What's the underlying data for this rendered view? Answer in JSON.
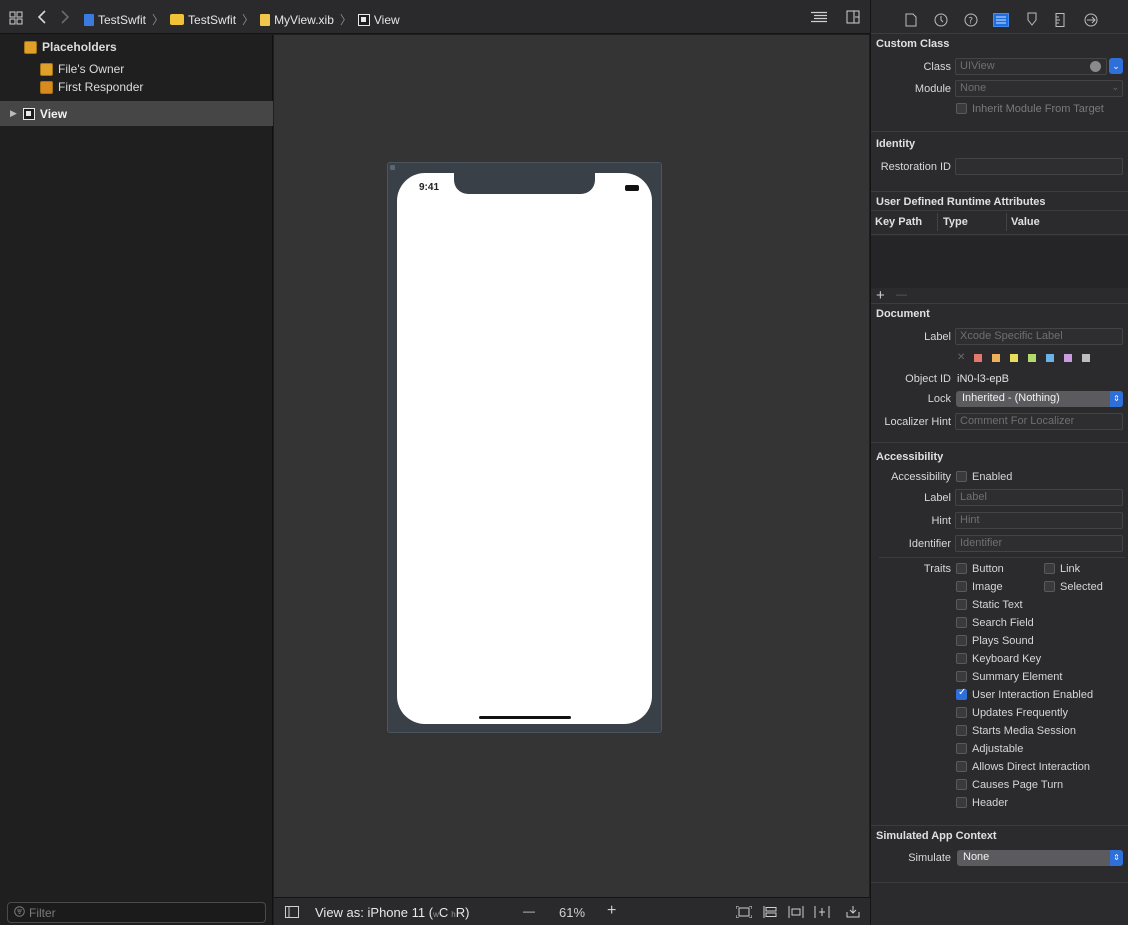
{
  "breadcrumb": {
    "items": [
      {
        "label": "TestSwfit"
      },
      {
        "label": "TestSwfit"
      },
      {
        "label": "MyView.xib"
      },
      {
        "label": "View"
      }
    ]
  },
  "outline": {
    "placeholders_label": "Placeholders",
    "files_owner_label": "File's Owner",
    "first_responder_label": "First Responder",
    "view_label": "View"
  },
  "filter": {
    "placeholder": "Filter"
  },
  "canvas": {
    "status_time": "9:41"
  },
  "bottombar": {
    "view_as_prefix": "View as: ",
    "device": "iPhone 11",
    "size_class_open": " (",
    "w_letter": "w",
    "compact_1": "C",
    "h_letter": "h",
    "regular": "R",
    "size_class_close": ")",
    "zoom": "61%",
    "zoom_out": "—",
    "zoom_in": "+"
  },
  "inspector": {
    "custom_class": {
      "title": "Custom Class",
      "class_label": "Class",
      "class_placeholder": "UIView",
      "module_label": "Module",
      "module_placeholder": "None",
      "inherit_label": "Inherit Module From Target"
    },
    "identity": {
      "title": "Identity",
      "restoration_label": "Restoration ID"
    },
    "runtime_attrs": {
      "title": "User Defined Runtime Attributes",
      "col_key": "Key Path",
      "col_type": "Type",
      "col_value": "Value",
      "add": "+",
      "remove": "—"
    },
    "document": {
      "title": "Document",
      "label_label": "Label",
      "label_placeholder": "Xcode Specific Label",
      "clear_mark": "✕",
      "object_id_label": "Object ID",
      "object_id": "iN0-l3-epB",
      "lock_label": "Lock",
      "lock_value": "Inherited - (Nothing)",
      "localizer_label": "Localizer Hint",
      "localizer_placeholder": "Comment For Localizer",
      "swatch_colors": [
        "#e5786d",
        "#eeb05c",
        "#e9de5c",
        "#b4d96b",
        "#6bb2e8",
        "#c99be0",
        "#bdbdbd"
      ]
    },
    "accessibility": {
      "title": "Accessibility",
      "accessibility_label": "Accessibility",
      "enabled_label": "Enabled",
      "label_label": "Label",
      "label_placeholder": "Label",
      "hint_label": "Hint",
      "hint_placeholder": "Hint",
      "identifier_label": "Identifier",
      "identifier_placeholder": "Identifier",
      "traits_label": "Traits",
      "traits_col1": [
        {
          "label": "Button",
          "checked": false
        },
        {
          "label": "Image",
          "checked": false
        },
        {
          "label": "Static Text",
          "checked": false
        },
        {
          "label": "Search Field",
          "checked": false
        },
        {
          "label": "Plays Sound",
          "checked": false
        },
        {
          "label": "Keyboard Key",
          "checked": false
        },
        {
          "label": "Summary Element",
          "checked": false
        },
        {
          "label": "User Interaction Enabled",
          "checked": true
        },
        {
          "label": "Updates Frequently",
          "checked": false
        },
        {
          "label": "Starts Media Session",
          "checked": false
        },
        {
          "label": "Adjustable",
          "checked": false
        },
        {
          "label": "Allows Direct Interaction",
          "checked": false
        },
        {
          "label": "Causes Page Turn",
          "checked": false
        },
        {
          "label": "Header",
          "checked": false
        }
      ],
      "traits_col2": [
        {
          "label": "Link",
          "checked": false
        },
        {
          "label": "Selected",
          "checked": false
        }
      ]
    },
    "simulated": {
      "title": "Simulated App Context",
      "simulate_label": "Simulate",
      "simulate_value": "None"
    }
  }
}
